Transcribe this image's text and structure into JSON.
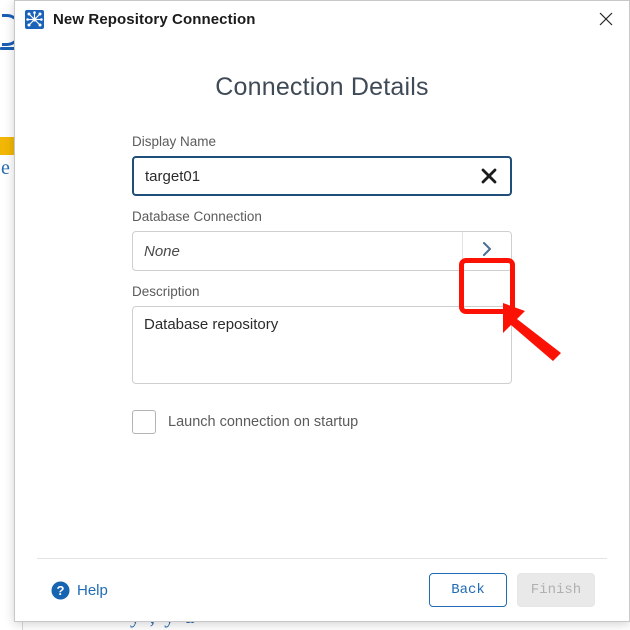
{
  "window": {
    "title": "New Repository Connection",
    "app_icon": "network-nodes-icon",
    "close_icon": "close-icon"
  },
  "page": {
    "heading": "Connection Details"
  },
  "form": {
    "display_name": {
      "label": "Display Name",
      "value": "target01",
      "clear_icon": "clear-x-icon"
    },
    "database_connection": {
      "label": "Database Connection",
      "placeholder": "None",
      "browse_icon": "chevron-right-icon"
    },
    "description": {
      "label": "Description",
      "value": "Database repository"
    },
    "launch_on_startup": {
      "label": "Launch connection on startup",
      "checked": false
    }
  },
  "footer": {
    "help_label": "Help",
    "help_icon": "question-circle-icon",
    "back_label": "Back",
    "finish_label": "Finish",
    "finish_disabled": true
  },
  "annotations": {
    "highlight_color": "#fb1204",
    "highlight_target": "database-connection-browse-button",
    "arrow_color": "#fb1204"
  },
  "background": {
    "bottom_text": "y  ,  y  u",
    "side_letter": "e",
    "accent_blue": "#1767b3",
    "accent_yellow": "#f2b705"
  }
}
